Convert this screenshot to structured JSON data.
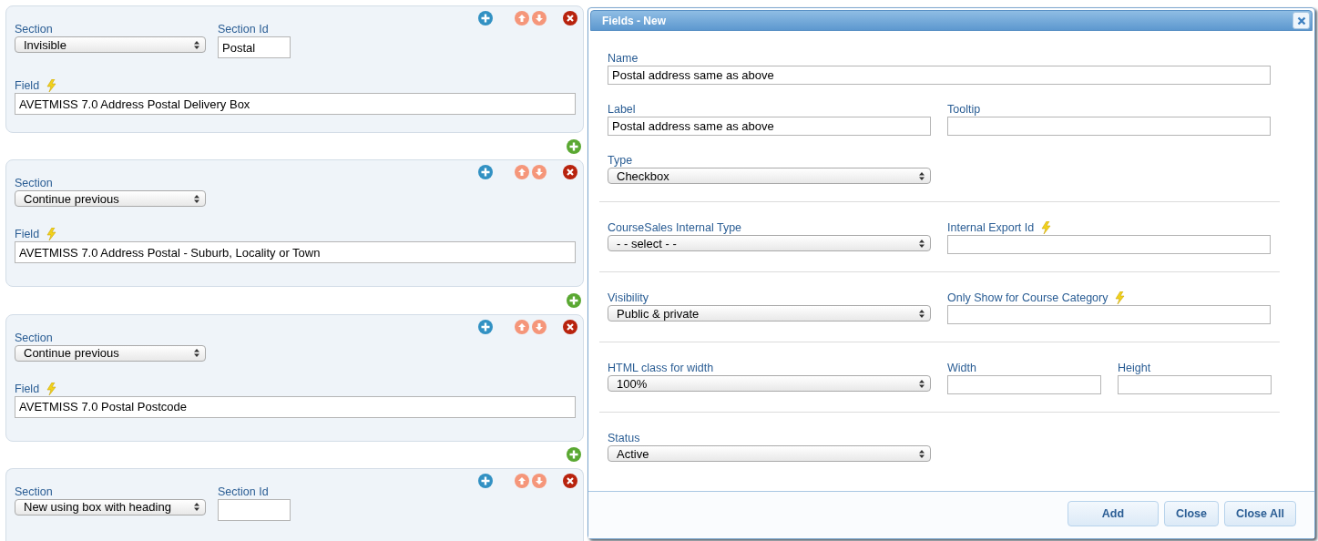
{
  "cards": [
    {
      "section": {
        "label": "Section",
        "value": "Invisible"
      },
      "section_id": {
        "label": "Section Id",
        "value": "Postal"
      },
      "field": {
        "label": "Field",
        "value": "AVETMISS 7.0 Address Postal Delivery Box"
      }
    },
    {
      "section": {
        "label": "Section",
        "value": "Continue previous"
      },
      "field": {
        "label": "Field",
        "value": "AVETMISS 7.0 Address Postal - Suburb, Locality or Town"
      }
    },
    {
      "section": {
        "label": "Section",
        "value": "Continue previous"
      },
      "field": {
        "label": "Field",
        "value": "AVETMISS 7.0 Postal Postcode"
      }
    },
    {
      "section": {
        "label": "Section",
        "value": "New using box with heading"
      },
      "section_id": {
        "label": "Section Id"
      }
    }
  ],
  "dialog": {
    "title": "Fields - New",
    "groups": [
      [
        [
          {
            "label": "Name",
            "kind": "text",
            "value": "Postal address same as above",
            "flash": false
          }
        ],
        [
          {
            "label": "Label",
            "kind": "text",
            "value": "Postal address same as above",
            "flash": false
          },
          {
            "label": "Tooltip",
            "kind": "text",
            "flash": false
          }
        ],
        [
          {
            "label": "Type",
            "kind": "select",
            "value": "Checkbox",
            "flash": false
          }
        ]
      ],
      [
        [
          {
            "label": "CourseSales Internal Type",
            "kind": "select",
            "value": "- - select - -",
            "flash": false
          },
          {
            "label": "Internal Export Id",
            "kind": "text",
            "flash": true
          }
        ]
      ],
      [
        [
          {
            "label": "Visibility",
            "kind": "select",
            "value": "Public & private",
            "flash": false
          },
          {
            "label": "Only Show for Course Category",
            "kind": "text",
            "flash": true
          }
        ]
      ],
      [
        [
          {
            "label": "HTML class for width",
            "kind": "select",
            "value": "100%",
            "flash": false
          },
          {
            "label": "Width",
            "kind": "text",
            "flash": false
          },
          {
            "label": "Height",
            "kind": "text",
            "flash": false
          }
        ]
      ],
      [
        [
          {
            "label": "Status",
            "kind": "select",
            "value": "Active",
            "flash": false
          }
        ]
      ]
    ],
    "buttons": [
      "Add",
      "Close",
      "Close All"
    ]
  }
}
